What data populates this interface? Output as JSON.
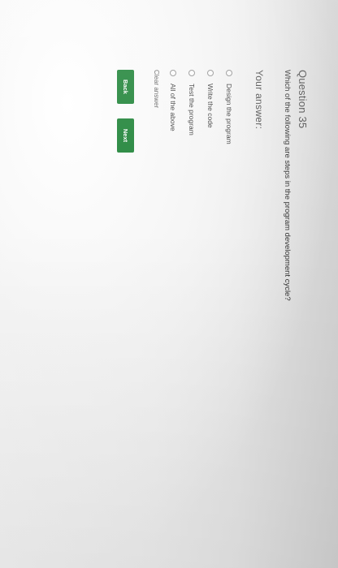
{
  "question": {
    "title": "Question 35",
    "text": "Which of the following are steps in the program development cycle?"
  },
  "answer_section": {
    "label": "Your answer:",
    "options": [
      {
        "label": "Design the program",
        "selected": false
      },
      {
        "label": "Write the code",
        "selected": false
      },
      {
        "label": "Test the program",
        "selected": false
      },
      {
        "label": "All of the above",
        "selected": false
      }
    ],
    "clear_label": "Clear answer"
  },
  "navigation": {
    "back_label": "Back",
    "next_label": "Next"
  },
  "colors": {
    "button_green": "#27883f"
  }
}
